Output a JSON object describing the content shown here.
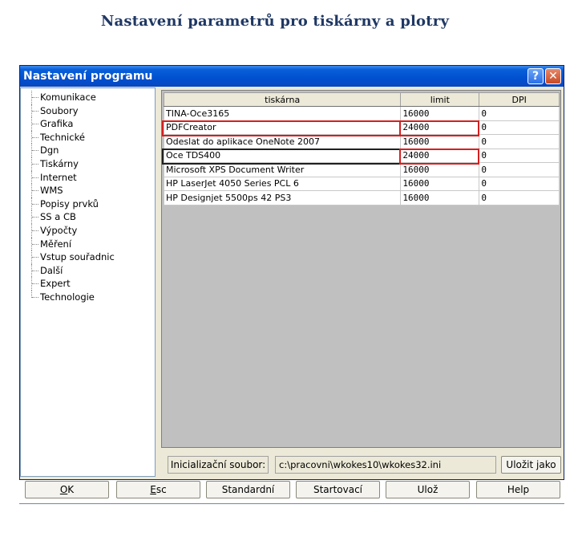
{
  "page": {
    "title": "Nastavení parametrů pro tiskárny a plotry"
  },
  "window": {
    "title": "Nastavení programu",
    "help_glyph": "?",
    "close_glyph": "✕"
  },
  "tree": {
    "items": [
      {
        "label": "Komunikace"
      },
      {
        "label": "Soubory"
      },
      {
        "label": "Grafika"
      },
      {
        "label": "Technické"
      },
      {
        "label": "Dgn"
      },
      {
        "label": "Tiskárny"
      },
      {
        "label": "Internet"
      },
      {
        "label": "WMS"
      },
      {
        "label": "Popisy prvků"
      },
      {
        "label": "SS a CB"
      },
      {
        "label": "Výpočty"
      },
      {
        "label": "Měření"
      },
      {
        "label": "Vstup souřadnic"
      },
      {
        "label": "Další"
      },
      {
        "label": "Expert"
      },
      {
        "label": "Technologie"
      }
    ]
  },
  "grid": {
    "columns": [
      "tiskárna",
      "limit",
      "DPI"
    ],
    "rows": [
      {
        "name": "TINA-Oce3165",
        "limit": "16000",
        "dpi": "0"
      },
      {
        "name": "PDFCreator",
        "limit": "24000",
        "dpi": "0"
      },
      {
        "name": "Odeslat do aplikace OneNote 2007",
        "limit": "16000",
        "dpi": "0"
      },
      {
        "name": "Oce TDS400",
        "limit": "24000",
        "dpi": "0"
      },
      {
        "name": "Microsoft XPS Document Writer",
        "limit": "16000",
        "dpi": "0"
      },
      {
        "name": "HP LaserJet 4050 Series PCL 6",
        "limit": "16000",
        "dpi": "0"
      },
      {
        "name": "HP Designjet 5500ps 42 PS3",
        "limit": "16000",
        "dpi": "0"
      }
    ]
  },
  "init": {
    "label": "Inicializační soubor:",
    "value": "c:\\pracovni\\wkokes10\\wkokes32.ini",
    "save_as": "Uložit jako"
  },
  "buttons": {
    "ok": "OK",
    "esc": "Esc",
    "standard": "Standardní",
    "startup": "Startovací",
    "save": "Ulož",
    "help": "Help"
  },
  "colors": {
    "title": "#1f3864",
    "highlight": "#d42020",
    "titlebar": "#0050d0"
  }
}
